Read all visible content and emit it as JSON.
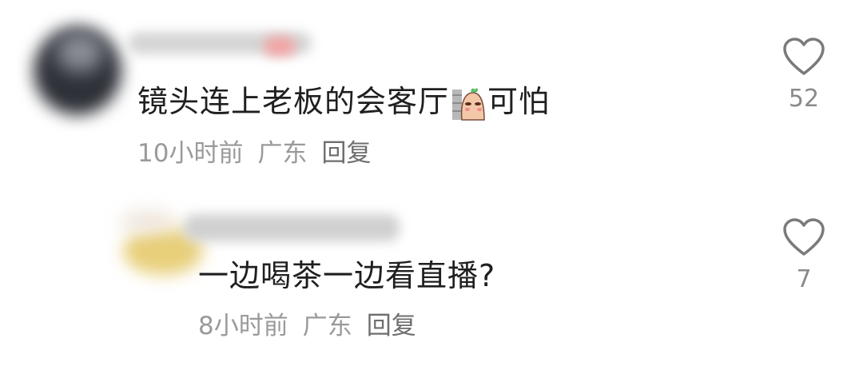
{
  "comments": [
    {
      "text_before": "镜头连上老板的会客厅",
      "text_after": "可怕",
      "sticker": "peeking-potato-sticker",
      "time": "10小时前",
      "location": "广东",
      "reply_label": "回复",
      "like_icon": "heart-outline-icon",
      "like_count": "52"
    },
    {
      "text": "一边喝茶一边看直播?",
      "time": "8小时前",
      "location": "广东",
      "reply_label": "回复",
      "like_icon": "heart-outline-icon",
      "like_count": "7"
    }
  ],
  "colors": {
    "text": "#1f1f1f",
    "meta": "#9a9a9a",
    "icon": "#7a7a7a"
  }
}
